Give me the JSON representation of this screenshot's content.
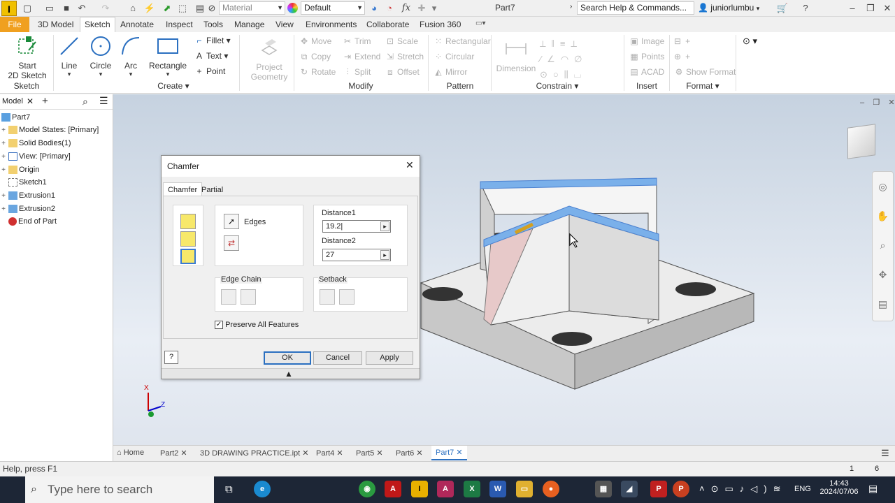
{
  "titlebar": {
    "material_label": "Material",
    "appearance_label": "Default",
    "app_title": "Part7",
    "search_placeholder": "Search Help & Commands...",
    "user": "juniorlumbu"
  },
  "menu": {
    "tabs": [
      "File",
      "3D Model",
      "Sketch",
      "Annotate",
      "Inspect",
      "Tools",
      "Manage",
      "View",
      "Environments",
      "Collaborate",
      "Fusion 360"
    ]
  },
  "ribbon": {
    "sketch": {
      "start": "Start",
      "start2": "2D Sketch",
      "group": "Sketch"
    },
    "create": {
      "line": "Line",
      "circle": "Circle",
      "arc": "Arc",
      "rectangle": "Rectangle",
      "fillet": "Fillet",
      "text": "Text",
      "point": "Point",
      "group": "Create"
    },
    "project": {
      "label1": "Project",
      "label2": "Geometry"
    },
    "modify": {
      "move": "Move",
      "trim": "Trim",
      "scale": "Scale",
      "copy": "Copy",
      "extend": "Extend",
      "stretch": "Stretch",
      "rotate": "Rotate",
      "split": "Split",
      "offset": "Offset",
      "group": "Modify"
    },
    "pattern": {
      "rectangular": "Rectangular",
      "circular": "Circular",
      "mirror": "Mirror",
      "group": "Pattern"
    },
    "constrain": {
      "dimension": "Dimension",
      "group": "Constrain"
    },
    "insert": {
      "image": "Image",
      "points": "Points",
      "acad": "ACAD",
      "group": "Insert"
    },
    "format": {
      "show_format": "Show Format",
      "group": "Format"
    }
  },
  "browser": {
    "tab": "Model",
    "items": [
      "Part7",
      "Model States: [Primary]",
      "Solid Bodies(1)",
      "View: [Primary]",
      "Origin",
      "Sketch1",
      "Extrusion1",
      "Extrusion2",
      "End of Part"
    ]
  },
  "dialog": {
    "title": "Chamfer",
    "tabs": [
      "Chamfer",
      "Partial"
    ],
    "edges_label": "Edges",
    "distance1_label": "Distance1",
    "distance1_value": "19.2",
    "distance2_label": "Distance2",
    "distance2_value": "27",
    "edge_chain_label": "Edge Chain",
    "setback_label": "Setback",
    "preserve_label": "Preserve All Features",
    "ok": "OK",
    "cancel": "Cancel",
    "apply": "Apply"
  },
  "doc_tabs": [
    "Home",
    "Part2",
    "3D DRAWING PRACTICE.ipt",
    "Part4",
    "Part5",
    "Part6",
    "Part7"
  ],
  "status": {
    "help": "Help, press F1",
    "n1": "1",
    "n2": "6"
  },
  "taskbar": {
    "search": "Type here to search",
    "lang": "ENG",
    "time": "14:43",
    "date": "2024/07/06"
  }
}
